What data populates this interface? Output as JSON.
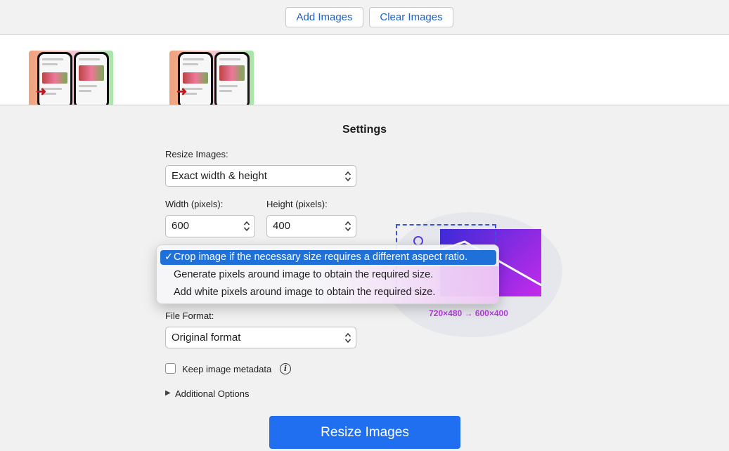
{
  "toolbar": {
    "add_images_label": "Add Images",
    "clear_images_label": "Clear Images"
  },
  "images": [
    {
      "icon": "image-thumbnail"
    },
    {
      "icon": "image-thumbnail"
    }
  ],
  "settings": {
    "title": "Settings",
    "resize_label": "Resize Images:",
    "resize_value": "Exact width & height",
    "width_label": "Width (pixels):",
    "width_value": "600",
    "height_label": "Height (pixels):",
    "height_value": "400",
    "aspect_options": [
      {
        "label": "Crop image if the necessary size requires a different aspect ratio.",
        "selected": true
      },
      {
        "label": "Generate pixels around image to obtain the required size.",
        "selected": false
      },
      {
        "label": "Add white pixels around image to obtain the required size.",
        "selected": false
      }
    ],
    "checkmark": "✓",
    "illustration_caption": "720×480 → 600×400",
    "format_label": "File Format:",
    "format_value": "Original format",
    "metadata_label": "Keep image metadata",
    "metadata_checked": false,
    "additional_options_label": "Additional Options",
    "resize_button_label": "Resize Images"
  },
  "colors": {
    "accent": "#1f6ff0",
    "selection": "#1f70d8",
    "link_text": "#2060c8",
    "caption": "#b43be0"
  }
}
